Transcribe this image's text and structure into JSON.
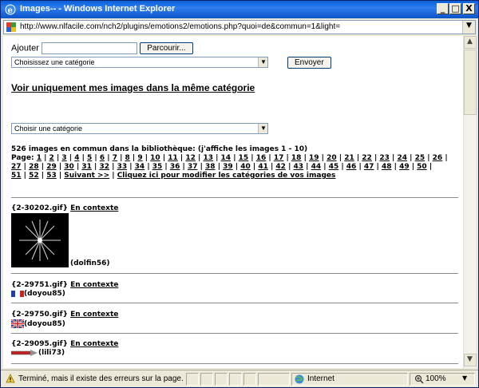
{
  "window": {
    "title": "Images-- - Windows Internet Explorer"
  },
  "address": {
    "url": "http://www.nlfacile.com/nch2/plugins/emotions2/emotions.php?quoi=de&commun=1&light="
  },
  "upload": {
    "label": "Ajouter",
    "browse_label": "Parcourir...",
    "category_select": "Choisissez une catégorie",
    "send_label": "Envoyer"
  },
  "filter": {
    "heading": "Voir uniquement mes images dans la même catégorie",
    "category_select": "Choisir une catégorie"
  },
  "summary": {
    "count_text": "526 images en commun dans la bibliothèque: (j'affiche les images 1 - 10)",
    "pages_label": "Page:",
    "pages_line1": [
      "1",
      "2",
      "3",
      "4",
      "5",
      "6",
      "7",
      "8",
      "9",
      "10",
      "11",
      "12",
      "13",
      "14",
      "15",
      "16",
      "17",
      "18",
      "19",
      "20",
      "21",
      "22",
      "23",
      "24",
      "25",
      "26"
    ],
    "pages_line2": [
      "27",
      "28",
      "29",
      "30",
      "31",
      "32",
      "33",
      "34",
      "35",
      "36",
      "37",
      "38",
      "39",
      "40",
      "41",
      "42",
      "43",
      "44",
      "45",
      "46",
      "47",
      "48",
      "49",
      "50"
    ],
    "pages_line3": [
      "51",
      "52",
      "53"
    ],
    "next_label": "Suivant >>",
    "modify_label": "Cliquez ici pour modifier les catégories de vos images"
  },
  "images": [
    {
      "file": "{2-30202.gif}",
      "context": "En contexte",
      "user": "(dolfin56)"
    },
    {
      "file": "{2-29751.gif}",
      "context": "En contexte",
      "user": "(doyou85)"
    },
    {
      "file": "{2-29750.gif}",
      "context": "En contexte",
      "user": "(doyou85)"
    },
    {
      "file": "{2-29095.gif}",
      "context": "En contexte",
      "user": "(lili73)"
    }
  ],
  "status": {
    "text": "Terminé, mais il existe des erreurs sur la page.",
    "zone": "Internet",
    "zoom": "100%"
  },
  "titlebar_buttons": {
    "minimize": "_",
    "maximize": "□",
    "close": "X"
  },
  "colors": {
    "titlebar": "#0a5fd8",
    "frame": "#ece9d8"
  }
}
